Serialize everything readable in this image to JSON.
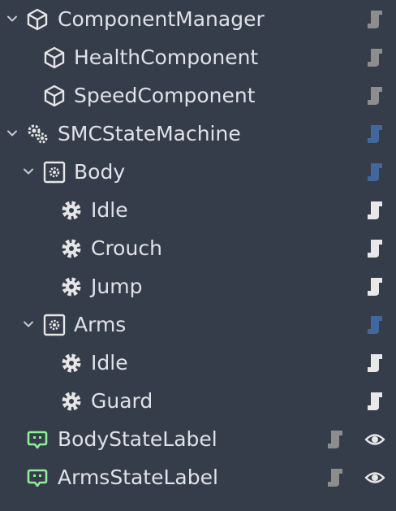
{
  "colors": {
    "background": "#363d4a",
    "text": "#dfe2e8",
    "script_gray": "#8d8d8d",
    "script_white": "#e8e8e8",
    "script_blue": "#41679c",
    "label_icon_green": "#8eef98"
  },
  "tree": {
    "nodes": [
      {
        "label": "ComponentManager",
        "icon": "box-icon",
        "expanded": true,
        "script": "gray"
      },
      {
        "label": "HealthComponent",
        "icon": "box-icon",
        "script": "gray"
      },
      {
        "label": "SpeedComponent",
        "icon": "box-icon",
        "script": "gray"
      },
      {
        "label": "SMCStateMachine",
        "icon": "state-machine-icon",
        "expanded": true,
        "script": "blue"
      },
      {
        "label": "Body",
        "icon": "state-box-icon",
        "expanded": true,
        "script": "blue"
      },
      {
        "label": "Idle",
        "icon": "gear-icon",
        "script": "white"
      },
      {
        "label": "Crouch",
        "icon": "gear-icon",
        "script": "white"
      },
      {
        "label": "Jump",
        "icon": "gear-icon",
        "script": "white"
      },
      {
        "label": "Arms",
        "icon": "state-box-icon",
        "expanded": true,
        "script": "blue"
      },
      {
        "label": "Idle",
        "icon": "gear-icon",
        "script": "white"
      },
      {
        "label": "Guard",
        "icon": "gear-icon",
        "script": "white"
      },
      {
        "label": "BodyStateLabel",
        "icon": "label-icon",
        "script": "gray",
        "visible_toggle": "eye-icon"
      },
      {
        "label": "ArmsStateLabel",
        "icon": "label-icon",
        "script": "gray",
        "visible_toggle": "eye-icon"
      }
    ]
  }
}
